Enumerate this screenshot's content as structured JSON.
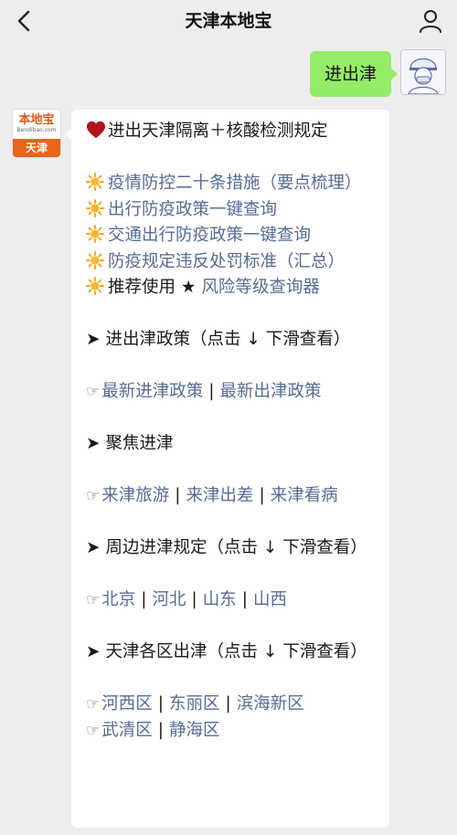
{
  "header": {
    "title": "天津本地宝"
  },
  "outgoing": {
    "text": "进出津"
  },
  "bot_avatar": {
    "brand": "本地宝",
    "site": "Bendibao.com",
    "city": "天津"
  },
  "message": {
    "headline": "进出天津隔离＋核酸检测规定",
    "items": [
      "疫情防控二十条措施（要点梳理）",
      "出行防疫政策一键查询",
      "交通出行防疫政策一键查询",
      "防疫规定违反处罚标准（汇总）"
    ],
    "recommend_label": "推荐使用 ★",
    "recommend_link": "风险等级查询器",
    "sections": [
      {
        "heading": "进出津政策（点击 ↓ 下滑查看）",
        "links": [
          "最新进津政策",
          "最新出津政策"
        ]
      },
      {
        "heading": "聚焦进津",
        "links": [
          "来津旅游",
          "来津出差",
          "来津看病"
        ]
      },
      {
        "heading": "周边进津规定（点击 ↓ 下滑查看）",
        "links": [
          "北京",
          "河北",
          "山东",
          "山西"
        ]
      },
      {
        "heading": "天津各区出津（点击 ↓ 下滑查看）",
        "links_row1": [
          "河西区",
          "东丽区",
          "滨海新区"
        ],
        "links_row2": [
          "武清区",
          "静海区"
        ]
      }
    ]
  },
  "icons": {
    "back": "chevron-left-icon",
    "user": "person-icon",
    "heart": "red-heart-icon",
    "sun": "sun-icon",
    "arrow": "right-arrowhead-icon",
    "finger": "pointing-hand-icon"
  },
  "colors": {
    "background": "#ededed",
    "outgoing_bubble": "#95ec69",
    "link": "#576b95",
    "brand_orange": "#e8641b"
  },
  "separator": "|",
  "arrow_glyph": "➤",
  "finger_glyph": "☞"
}
